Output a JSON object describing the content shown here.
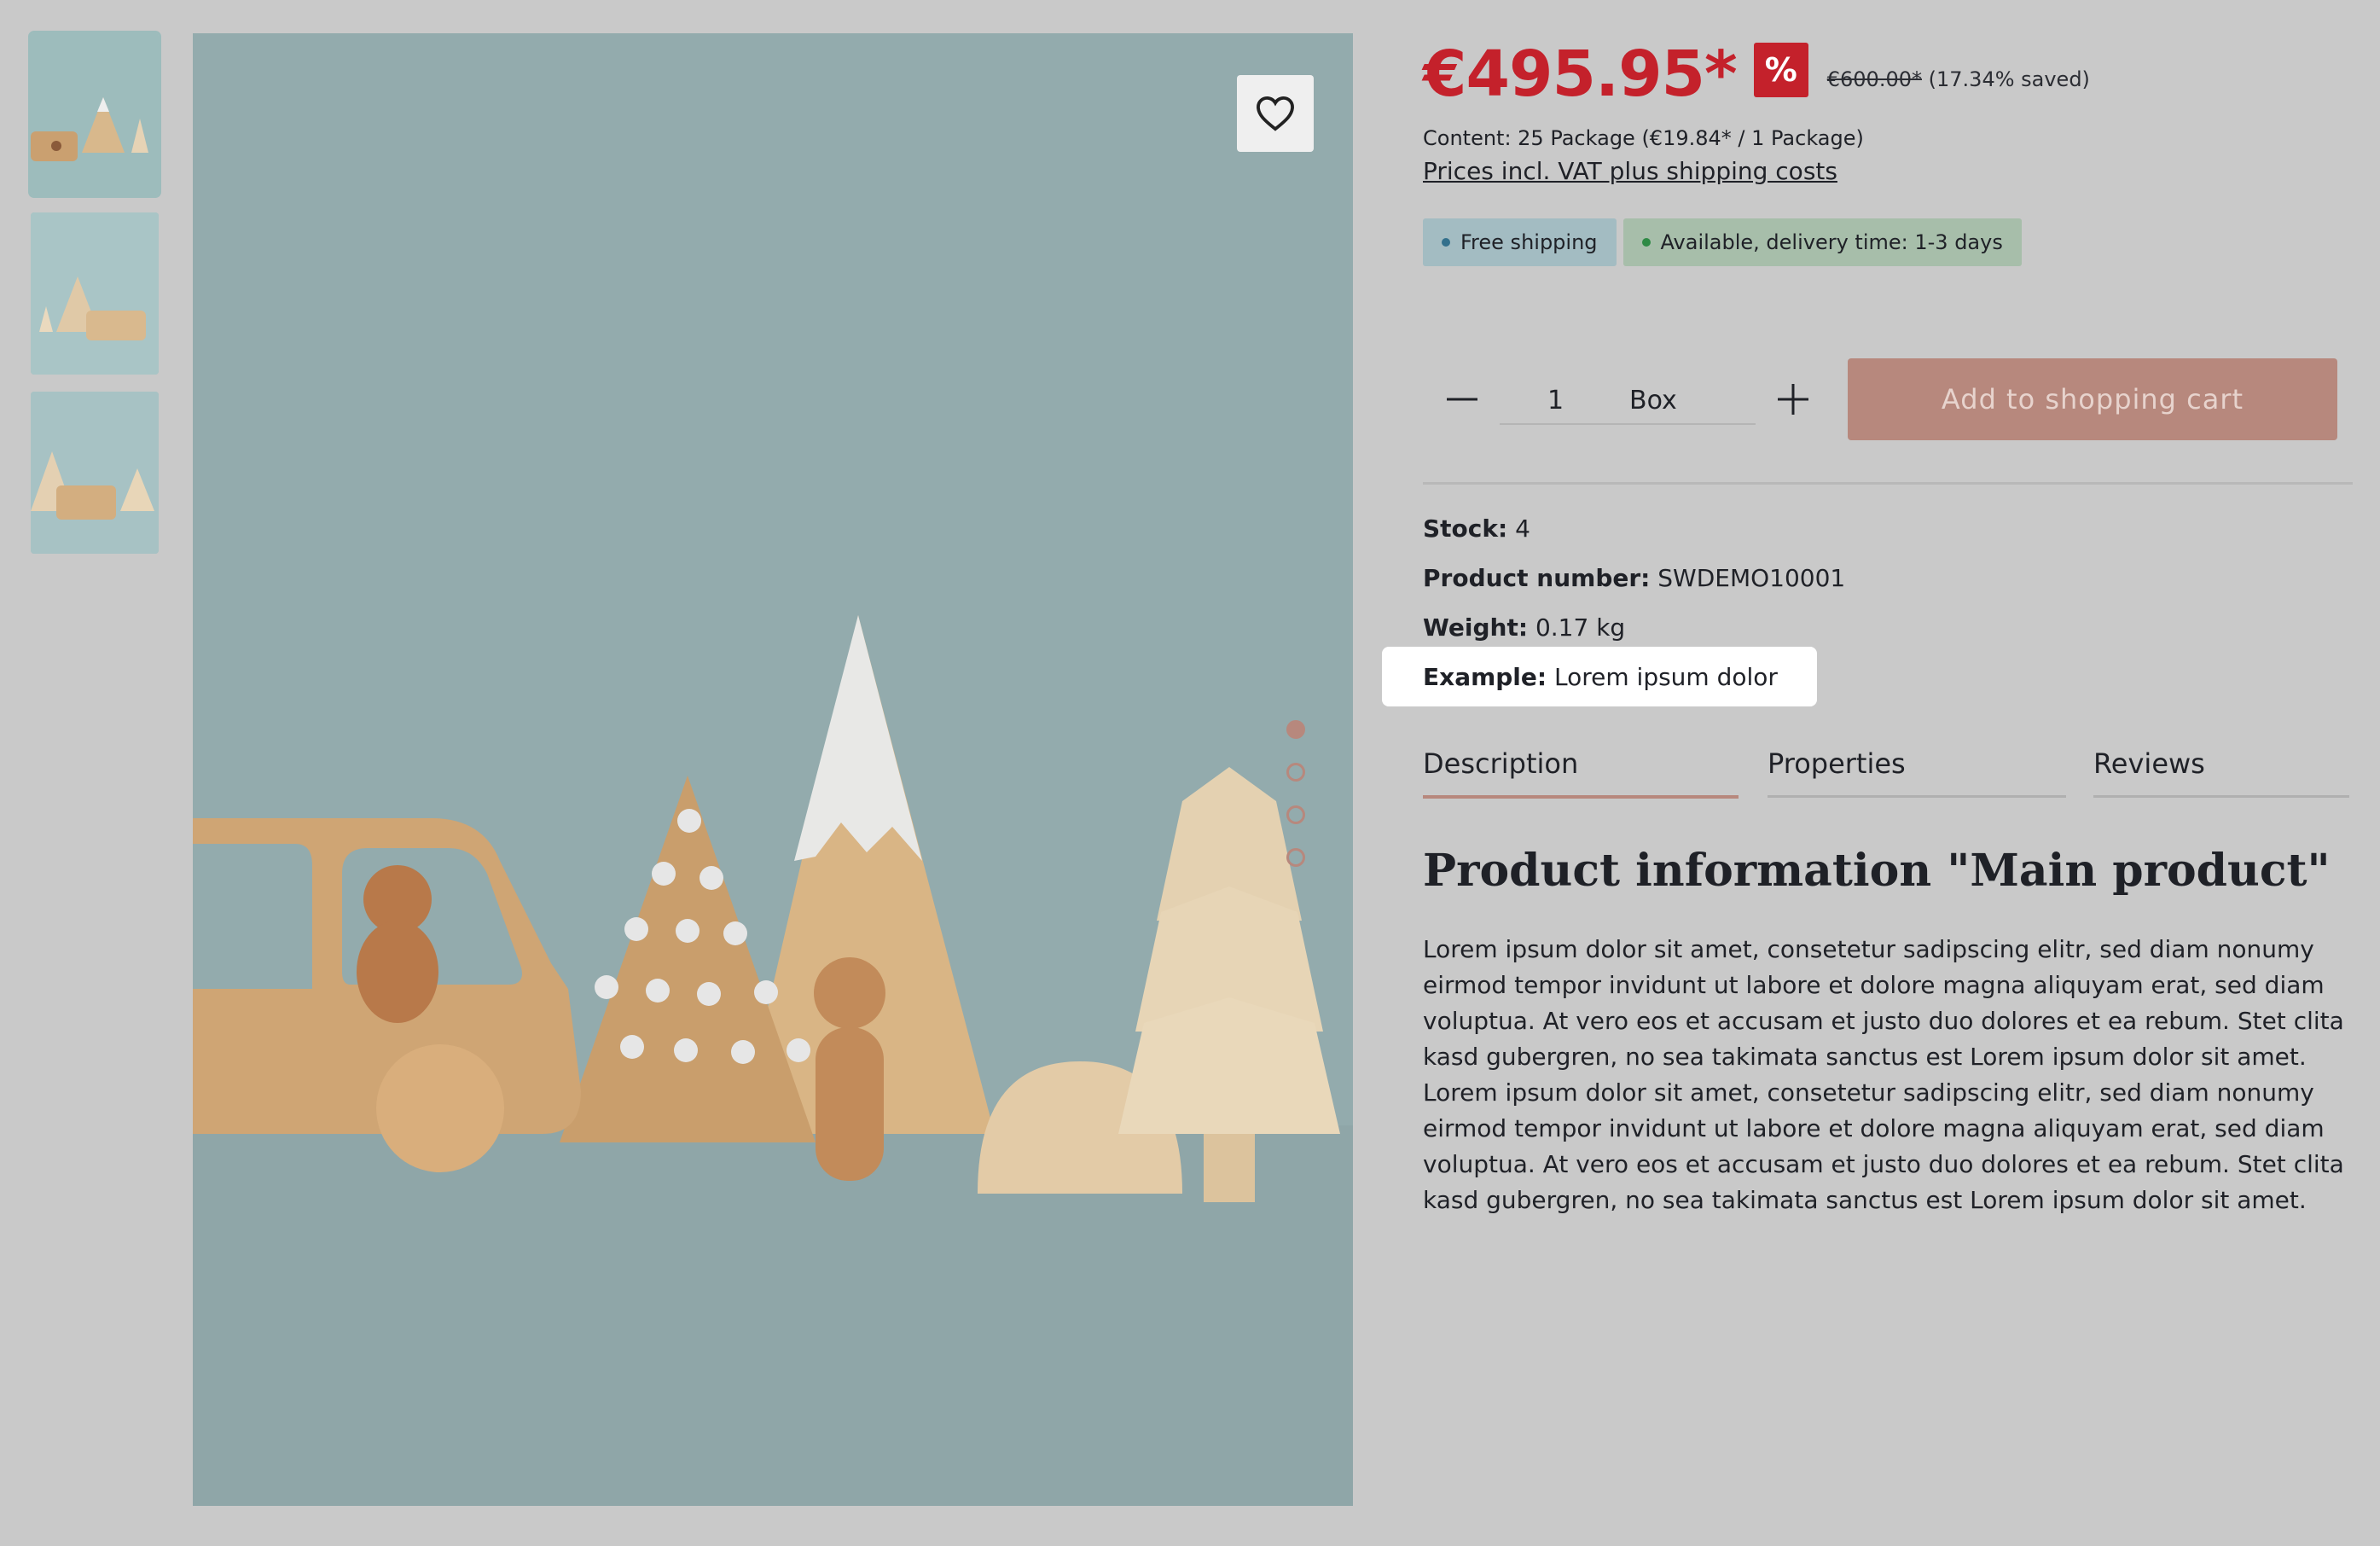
{
  "wishlist": {
    "icon": "heart-icon"
  },
  "price": {
    "current": "€495.95*",
    "discount_badge": "%",
    "list_price": "€600.00*",
    "saved": "(17.34% saved)",
    "content": "Content: 25 Package (€19.84* / 1 Package)",
    "vat_link": "Prices incl. VAT plus shipping costs"
  },
  "labels": {
    "free_shipping": "Free shipping",
    "availability": "Available, delivery time: 1-3 days"
  },
  "quantity": {
    "value": "1",
    "unit": "Box"
  },
  "cart_button": "Add to shopping cart",
  "specs": [
    {
      "label": "Stock:",
      "value": "4"
    },
    {
      "label": "Product number:",
      "value": "SWDEMO10001"
    },
    {
      "label": "Weight:",
      "value": "0.17 kg"
    },
    {
      "label": "Example:",
      "value": "Lorem ipsum dolor"
    }
  ],
  "tabs": [
    "Description",
    "Properties",
    "Reviews"
  ],
  "description": {
    "title": "Product information \"Main product\"",
    "body": "Lorem ipsum dolor sit amet, consetetur sadipscing elitr, sed diam nonumy eirmod tempor invidunt ut labore et dolore magna aliquyam erat, sed diam voluptua. At vero eos et accusam et justo duo dolores et ea rebum. Stet clita kasd gubergren, no sea takimata sanctus est Lorem ipsum dolor sit amet. Lorem ipsum dolor sit amet, consetetur sadipscing elitr, sed diam nonumy eirmod tempor invidunt ut labore et dolore magna aliquyam erat, sed diam voluptua. At vero eos et accusam et justo duo dolores et ea rebum. Stet clita kasd gubergren, no sea takimata sanctus est Lorem ipsum dolor sit amet."
  },
  "colors": {
    "sale_red": "#c4212b",
    "accent": "#b7887d",
    "image_bg": "#93abad"
  }
}
